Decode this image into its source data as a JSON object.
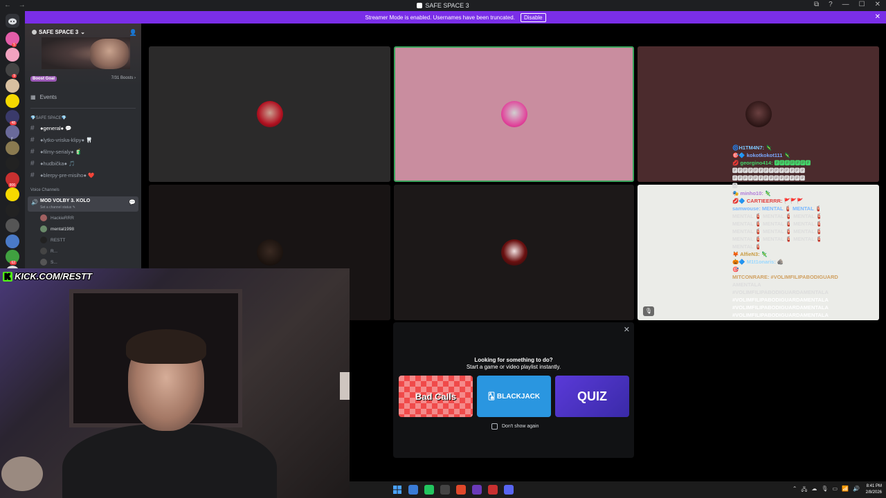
{
  "window": {
    "title": "SAFE SPACE 3",
    "nav": "← →",
    "controls": [
      "⧉",
      "?",
      "—",
      "☐",
      "✕"
    ]
  },
  "banner": {
    "message": "Streamer Mode is enabled. Usernames have been truncated.",
    "disable_label": "Disable",
    "close": "✕"
  },
  "rail_servers": [
    {
      "color": "#e35da8",
      "badge": "5"
    },
    {
      "color": "#f2a3c0",
      "badge": ""
    },
    {
      "color": "#444444",
      "badge": "9"
    },
    {
      "color": "#d8c0a0",
      "badge": ""
    },
    {
      "color": "#f5d900",
      "badge": ""
    },
    {
      "color": "#3a3a6a",
      "badge": "48"
    },
    {
      "color": "#6a6a9a",
      "badge": ""
    },
    {
      "color": "#8a7a50",
      "badge": ""
    },
    {
      "color": "#222222",
      "badge": ""
    },
    {
      "color": "#c83030",
      "badge": "906"
    },
    {
      "color": "#f5d900",
      "badge": ""
    },
    {
      "color": "#222222",
      "badge": ""
    },
    {
      "color": "#555555",
      "badge": ""
    },
    {
      "color": "#4a7ac8",
      "badge": ""
    },
    {
      "color": "#40a040",
      "badge": "62"
    },
    {
      "color": "#dddddd",
      "badge": ""
    }
  ],
  "rail_letter": "r",
  "server": {
    "name": "SAFE SPACE 3",
    "chevron": "⌄",
    "invite_icon": "👤",
    "boost_goal": "Boost Goal",
    "boost_count": "7/31 Boosts ›",
    "events_label": "Events",
    "category": "💎SAFE SPACE💎",
    "channels": [
      {
        "name": "●general● 💬",
        "active": true
      },
      {
        "name": "●lytko-vriska-klipy● 🦷",
        "active": false
      },
      {
        "name": "●filmy-serialy● 🧃",
        "active": false
      },
      {
        "name": "●hudbička● 🎵",
        "active": false
      },
      {
        "name": "●blerpy-pre-misiho● ❤️",
        "active": false
      }
    ],
    "voice_category": "Voice Channels",
    "voice_channel": {
      "name": "MOD VOLBY 3. KOLO",
      "status": "Set a channel status ✎"
    },
    "voice_users": [
      {
        "name": "HackieRRR",
        "color": "#a06060",
        "bright": false
      },
      {
        "name": "mental1998",
        "color": "#6a8a6a",
        "bright": true
      },
      {
        "name": "RESTT",
        "color": "#222222",
        "bright": false
      },
      {
        "name": "R...",
        "color": "#444444",
        "bright": false
      },
      {
        "name": "S...",
        "color": "#555555",
        "bright": false
      }
    ]
  },
  "tiles": [
    {
      "bg": "#2b2a2a",
      "avatar": "radial-gradient(circle at 50% 45%, #c9a090 0%, #b01020 60%, #401010 100%)",
      "border": "none",
      "mic": false
    },
    {
      "bg": "#c98d9f",
      "avatar": "radial-gradient(circle at 50% 45%, #d0d0d0 0%, #e0429a 65%, #b02070 100%)",
      "border": "2px solid #3ba55d",
      "mic": false
    },
    {
      "bg": "#4b2b2d",
      "avatar": "radial-gradient(circle at 50% 45%, #6a4040 0%, #2a1414 70%, #100808 100%)",
      "border": "none",
      "mic": false
    },
    {
      "bg": "#181414",
      "avatar": "radial-gradient(circle at 50% 45%, #3a2a22 0%, #1a120e 70%, #0a0606 100%)",
      "border": "none",
      "mic": false
    },
    {
      "bg": "#1c1818",
      "avatar": "radial-gradient(circle at 50% 45%, #f0e0e0 0%, #6a1010 55%, #1a0a0a 100%)",
      "border": "none",
      "mic": false
    },
    {
      "bg": "#ebece8",
      "avatar": "",
      "border": "none",
      "mic": true
    }
  ],
  "mic_icon": "🎙",
  "kick_overlay": "KICK.COM/RESTT",
  "kick_k": "K",
  "chat_lines": [
    {
      "text": "🌀H1TM4N7: 🦎",
      "color": "#7ec8ff"
    },
    {
      "text": "🎯🔷 kokotkokot111 🦎",
      "color": "#7aa8ff"
    },
    {
      "text": "💋 georgino414: 🅿🅿🅿🅿🅿🅿🅿",
      "color": "#44d46a"
    },
    {
      "text": "🅿🅿🅿🅿🅿🅿🅿🅿🅿🅿🅿🅿🅿🅿",
      "color": "#dddddd"
    },
    {
      "text": "🅿🅿🅿🅿🅿🅿🅿🅿🅿🅿🅿🅿🅿🅿",
      "color": "#dddddd"
    },
    {
      "text": "🅿",
      "color": "#dddddd"
    },
    {
      "text": "🎭 minho10: 🦎",
      "color": "#b07ad8"
    },
    {
      "text": "💋🔷 CARTIEERRR: 🚩🚩🚩",
      "color": "#e04040"
    },
    {
      "text": "samwouse: MENTAL 🧯 MENTAL 🧯",
      "color": "#7ab8ff"
    },
    {
      "text": "MENTAL 🧯 MENTAL 🧯 MENTAL 🧯",
      "color": "#dddddd"
    },
    {
      "text": "MENTAL 🧯 MENTAL 🧯 MENTAL 🧯",
      "color": "#dddddd"
    },
    {
      "text": "MENTAL 🧯 MENTAL 🧯 MENTAL 🧯",
      "color": "#dddddd"
    },
    {
      "text": "MENTAL 🧯 MENTAL 🧯 MENTAL 🧯",
      "color": "#dddddd"
    },
    {
      "text": "MENTAL 🧯",
      "color": "#dddddd"
    },
    {
      "text": "🦊 AlfieN3: 🦎",
      "color": "#c89a40"
    },
    {
      "text": "🎃🔷 M1t1onaris: 🪨",
      "color": "#9ad8ff"
    },
    {
      "text": "🎯",
      "color": "#dddddd"
    },
    {
      "text": "MITCONRARE: #VOLIMFILIPABODIGUARD",
      "color": "#d0a060"
    },
    {
      "text": "AMENTALA",
      "color": "#dddddd"
    },
    {
      "text": "#VOLIMFILIPABODIGUARDAMENTALA",
      "color": "#dddddd"
    },
    {
      "text": "#VOLIMFILIPABODIGUARDAMENTALA",
      "color": "#ffffff"
    },
    {
      "text": "#VOLIMFILIPABODIGUARDAMENTALA",
      "color": "#ffffff"
    },
    {
      "text": "#VOLIMFILIPABODIGUARDAMENTALA",
      "color": "#ffffff"
    }
  ],
  "activity_popup": {
    "title": "Looking for something to do?",
    "subtitle": "Start a game or video playlist instantly.",
    "close": "✕",
    "games": [
      {
        "label": "Bad Calls",
        "key": "bad"
      },
      {
        "label": "🂡 BLACKJACK",
        "key": "bj"
      },
      {
        "label": "QUIZ",
        "key": "quiz"
      }
    ],
    "dont_show": "Don't show again"
  },
  "taskbar": {
    "apps": [
      "#3a7bd5",
      "#22c55e",
      "#444444",
      "#e0482a",
      "#6a3ab8",
      "#c83030",
      "#5865f2"
    ],
    "tray": [
      "⌃",
      "🖧",
      "☁",
      "🎙",
      "▭",
      "📶",
      "🔊"
    ],
    "time": "8:41 PM",
    "date": "2/8/2026"
  }
}
